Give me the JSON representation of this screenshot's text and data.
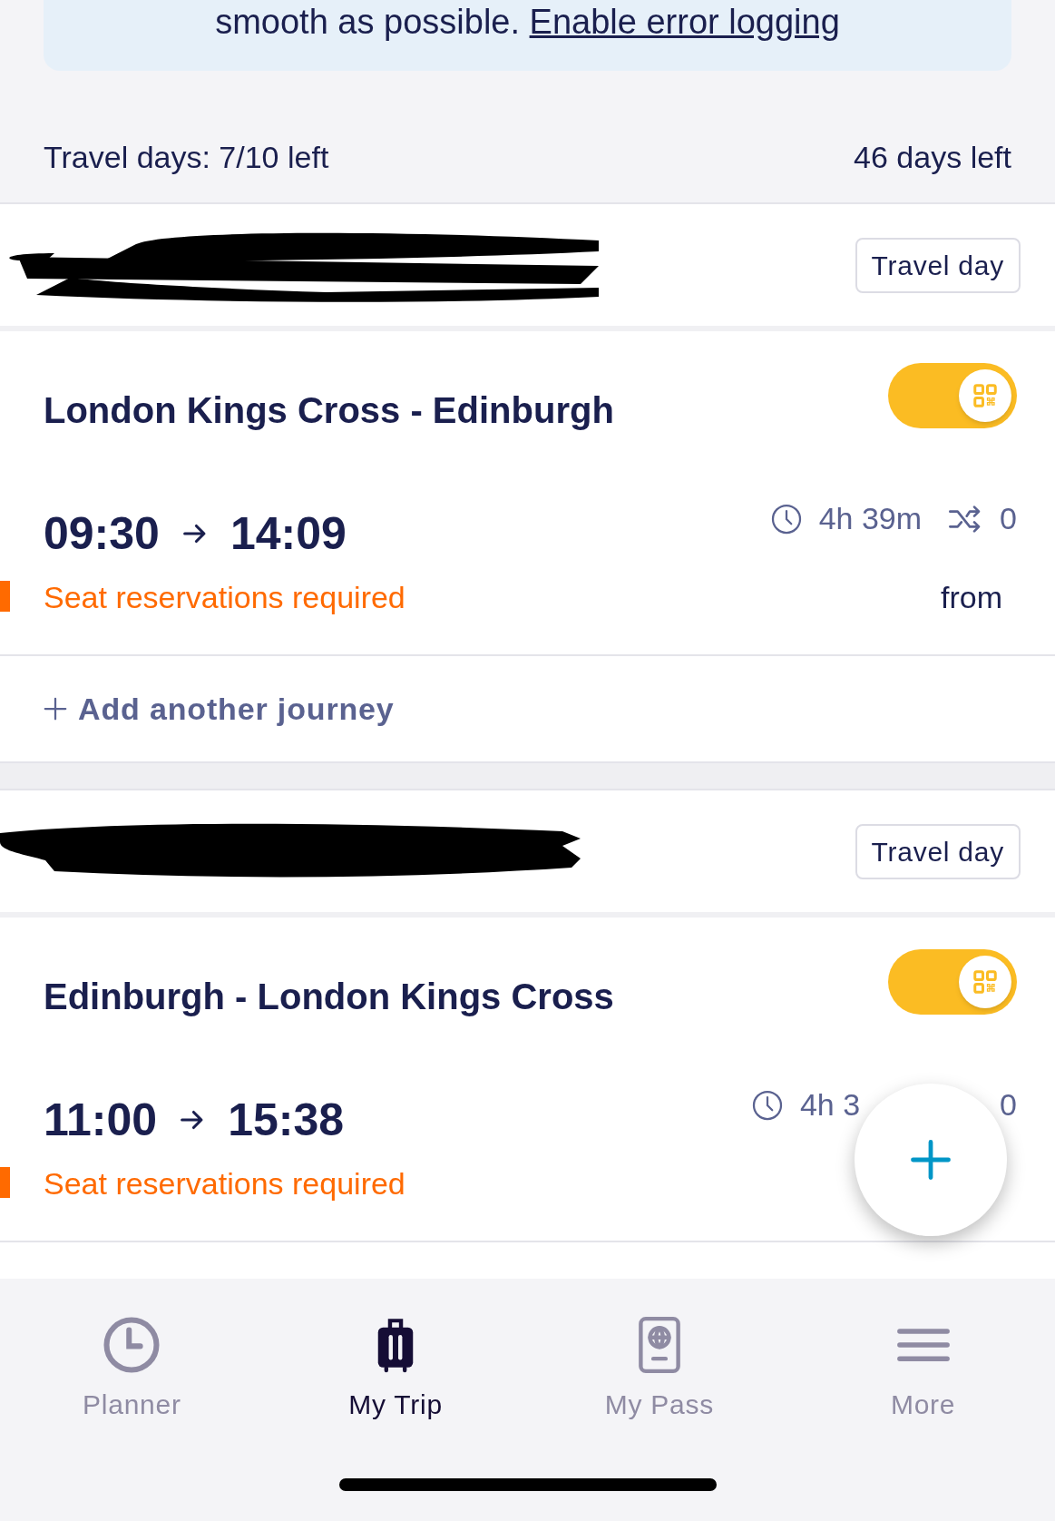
{
  "banner": {
    "text": "smooth as possible. ",
    "link": "Enable error logging"
  },
  "summary": {
    "travel_days": "Travel days: 7/10 left",
    "days_left": "46 days left"
  },
  "days": [
    {
      "badge": "Travel day",
      "journeys": [
        {
          "kind": "full",
          "title": "London Kings Cross - Edinburgh",
          "qr_on": true,
          "depart": "09:30",
          "arrive": "14:09",
          "duration": "4h 39m",
          "transfers": "0",
          "notice": "Seat reservations required",
          "price_label": "from"
        }
      ],
      "add_label": "Add another journey"
    },
    {
      "badge": "Travel day",
      "journeys": [
        {
          "kind": "covered",
          "title": "Edinburgh - London Kings Cross",
          "qr_on": true,
          "depart": "11:00",
          "arrive": "15:38",
          "duration": "4h 3",
          "transfers": "0",
          "notice": "Seat reservations required"
        }
      ]
    }
  ],
  "nav": [
    {
      "label": "Planner",
      "kind": "clock",
      "selected": false
    },
    {
      "label": "My Trip",
      "kind": "suitcase",
      "selected": true
    },
    {
      "label": "My Pass",
      "kind": "passport",
      "selected": false
    },
    {
      "label": "More",
      "kind": "menu",
      "selected": false
    }
  ]
}
